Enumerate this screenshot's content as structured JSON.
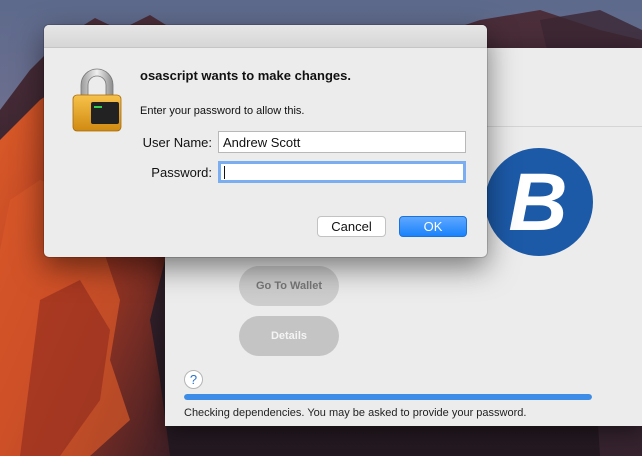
{
  "colors": {
    "accent": "#1a82fb",
    "progress": "#3d8de8",
    "logo_blue": "#1c5aa8"
  },
  "background_window": {
    "go_to_wallet_label": "Go To Wallet",
    "details_label": "Details",
    "help_label": "?",
    "progress_fraction": 1.0,
    "status_text": "Checking dependencies. You may be asked to provide your password.",
    "logo_letter": "B"
  },
  "dialog": {
    "title": "osascript wants to make changes.",
    "subtitle": "Enter your password to allow this.",
    "username_label": "User Name:",
    "username_value": "Andrew Scott",
    "password_label": "Password:",
    "password_value": "",
    "cancel_label": "Cancel",
    "ok_label": "OK",
    "icon": "lock-icon"
  }
}
